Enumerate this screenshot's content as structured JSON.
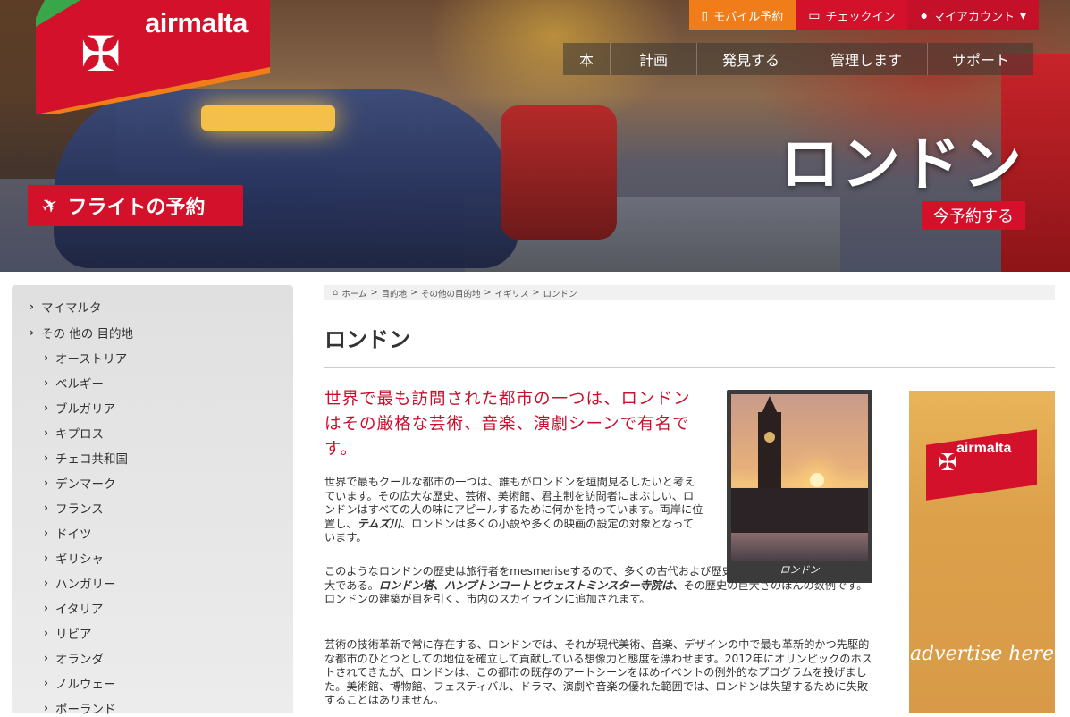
{
  "brand": {
    "logo_text": "airmalta"
  },
  "util_bar": {
    "mobile": "モバイル予約",
    "checkin": "チェックイン",
    "account": "マイアカウント"
  },
  "nav": [
    "本",
    "計画",
    "発見する",
    "管理します",
    "サポート"
  ],
  "hero": {
    "city": "ロンドン",
    "book_now": "今予約する",
    "flight_booking": "フライトの予約"
  },
  "sidebar": {
    "top": [
      "マイマルタ",
      "その 他の 目的地"
    ],
    "countries": [
      "オーストリア",
      "ベルギー",
      "ブルガリア",
      "キプロス",
      "チェコ共和国",
      "デンマーク",
      "フランス",
      "ドイツ",
      "ギリシャ",
      "ハンガリー",
      "イタリア",
      "リビア",
      "オランダ",
      "ノルウェー",
      "ポーランド"
    ]
  },
  "breadcrumb": {
    "items": [
      "ホーム",
      "目的地",
      "その他の目的地",
      "イギリス",
      "ロンドン"
    ],
    "separator": ">"
  },
  "page": {
    "title": "ロンドン",
    "lead": "世界で最も訪問された都市の一つは、ロンドンはその厳格な芸術、音楽、演劇シーンで有名です。",
    "p1": "世界で最もクールな都市の一つは、誰もがロンドンを垣間見るしたいと考えています。その広大な歴史、芸術、美術館、君主制を訪問者にまぶしい、ロンドンはすべての人の味にアピールするために何かを持っています。両岸に位置し、",
    "p1_bold": "テムズ川",
    "p1_tail": "、ロンドンは多くの小説や多くの映画の設定の対象となっています。",
    "p2": "このようなロンドンの歴史は旅行者をmesmeriseするので、多くの古代および歴史的な壮大さがあることが広大である。",
    "p2_bold": "ロンドン塔、ハンプトンコートとウェストミンスター寺院は、",
    "p2_tail": "その歴史の巨大さのほんの数例です。ロンドンの建築が目を引く、市内のスカイラインに追加されます。",
    "p3": "芸術の技術革新で常に存在する、ロンドンでは、それが現代美術、音楽、デザインの中で最も革新的かつ先駆的な都市のひとつとしての地位を確立して貢献している想像力と態度を漂わせます。2012年にオリンピックのホストされてきたが、ロンドンは、この都市の既存のアートシーンをほめイベントの例外的なプログラムを投げました。美術館、博物館、フェスティバル、ドラマ、演劇や音楽の優れた範囲では、ロンドンは失望するために失敗することはありません。",
    "photo_caption": "ロンドン"
  },
  "ad": {
    "logo_text": "airmalta",
    "text": "advertise here"
  },
  "colors": {
    "brand_red": "#d3112a",
    "orange": "#f07d1a",
    "lead_red": "#c8102e"
  }
}
